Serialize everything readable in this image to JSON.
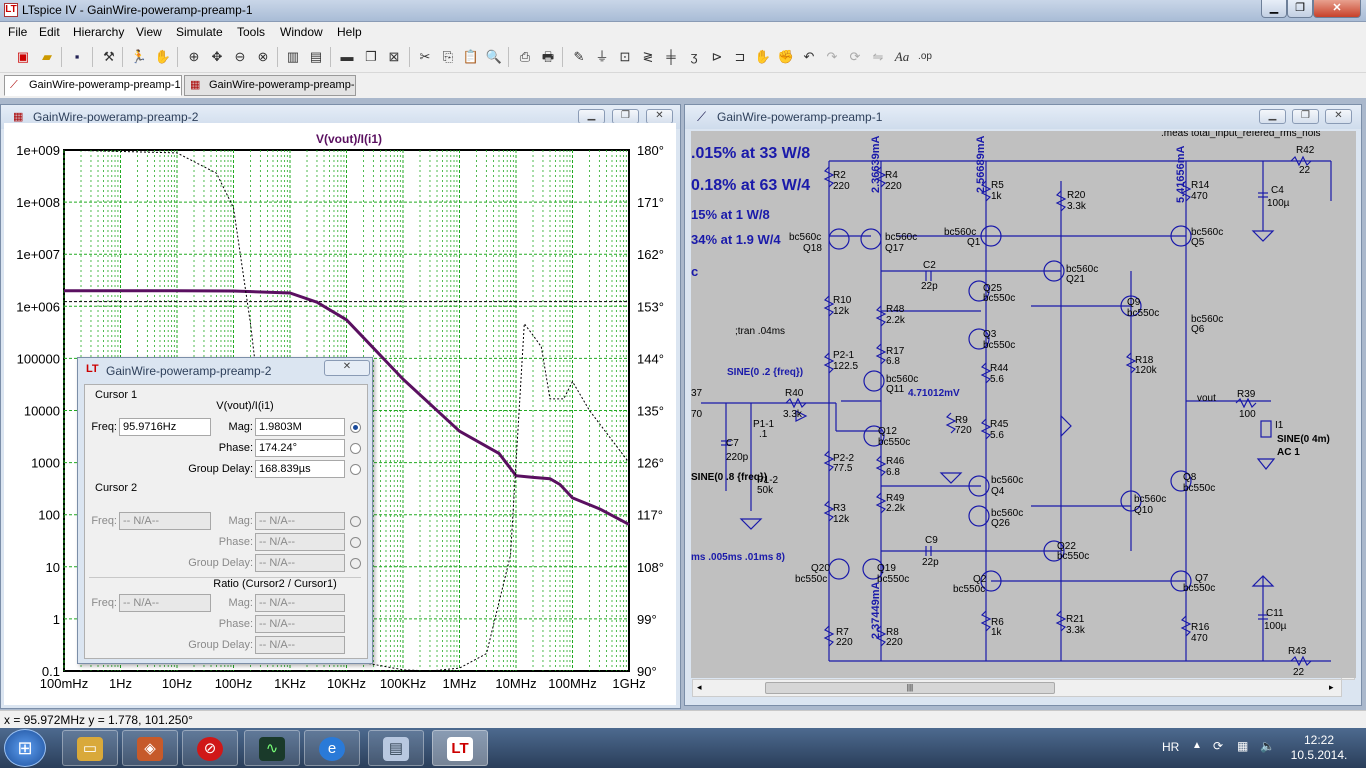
{
  "app": {
    "title": "LTspice IV - GainWire-poweramp-preamp-1",
    "icon": "ltspice-logo-icon"
  },
  "menu": [
    "File",
    "Edit",
    "Hierarchy",
    "View",
    "Simulate",
    "Tools",
    "Window",
    "Help"
  ],
  "tabs": [
    {
      "label": "GainWire-poweramp-preamp-1",
      "active": true
    },
    {
      "label": "GainWire-poweramp-preamp-2",
      "active": false
    }
  ],
  "plot_window": {
    "title": "GainWire-poweramp-preamp-2",
    "trace_label": "V(vout)/I(i1)"
  },
  "chart_data": {
    "type": "line",
    "title": "V(vout)/I(i1)",
    "xscale": "log",
    "yscale": "log",
    "x_ticks": [
      "100mHz",
      "1Hz",
      "10Hz",
      "100Hz",
      "1KHz",
      "10KHz",
      "100KHz",
      "1MHz",
      "10MHz",
      "100MHz",
      "1GHz"
    ],
    "y_ticks": [
      "1e+009",
      "1e+008",
      "1e+007",
      "1e+006",
      "100000",
      "10000",
      "1000",
      "100",
      "10",
      "1",
      "0.1"
    ],
    "y2_ticks": [
      "180°",
      "171°",
      "162°",
      "153°",
      "144°",
      "135°",
      "126°",
      "117°",
      "108°",
      "99°",
      "90°"
    ],
    "xlim": [
      0.1,
      1000000000
    ],
    "ylim": [
      0.1,
      1000000000
    ],
    "y2lim": [
      90,
      180
    ],
    "grid": true,
    "series": [
      {
        "name": "V(vout)/I(i1)",
        "style": "magnitude",
        "color": "#5a1060",
        "x": [
          0.1,
          1,
          10,
          100,
          1000,
          3000,
          10000,
          100000,
          1000000,
          5000000,
          10000000,
          20000000,
          40000000,
          60000000,
          100000000,
          300000000,
          1000000000
        ],
        "y": [
          1980000,
          1980000,
          1980000,
          1970000,
          1800000,
          1200000,
          550000,
          40000,
          4000,
          1500,
          560,
          520,
          490,
          380,
          210,
          130,
          65
        ]
      },
      {
        "name": "phase",
        "style": "dashed",
        "color": "#000000",
        "x": [
          0.1,
          10,
          50,
          100,
          200,
          400,
          800,
          2000,
          10000,
          100000,
          300000,
          1000000,
          3000000,
          8000000,
          14000000,
          20000000,
          28000000,
          40000000,
          70000000,
          100000000,
          200000000,
          1000000000
        ],
        "y": [
          180,
          179.5,
          176,
          170,
          150,
          125,
          108,
          98,
          92,
          90.2,
          90,
          90.5,
          93,
          110,
          150,
          148,
          146,
          137,
          137,
          140,
          135,
          126
        ]
      }
    ],
    "reference_line": {
      "y2": 153.8,
      "style": "dashed"
    }
  },
  "cursor_dialog": {
    "title": "GainWire-poweramp-preamp-2",
    "cursor1_label": "Cursor 1",
    "cursor2_label": "Cursor 2",
    "trace": "V(vout)/I(i1)",
    "c1": {
      "freq": "95.9716Hz",
      "mag": "1.9803M",
      "phase": "174.24°",
      "group_delay": "168.839µs"
    },
    "c2": {
      "freq": "-- N/A--",
      "mag": "-- N/A--",
      "phase": "-- N/A--",
      "group_delay": "-- N/A--"
    },
    "ratio_label": "Ratio (Cursor2 / Cursor1)",
    "ratio": {
      "freq": "-- N/A--",
      "mag": "-- N/A--",
      "phase": "-- N/A--",
      "group_delay": "-- N/A--"
    },
    "labels": {
      "freq": "Freq:",
      "mag": "Mag:",
      "phase": "Phase:",
      "group_delay": "Group Delay:"
    }
  },
  "schematic_window": {
    "title": "GainWire-poweramp-preamp-1",
    "big_text": [
      ".015% at 33 W/8",
      "0.18% at 63 W/4",
      "15% at 1 W/8",
      "34% at 1.9 W/4"
    ],
    "directives": [
      ".meas total_input_refered_rms_nois",
      ";tran .04ms",
      "SINE(0 .2 {freq})",
      "SINE(0 .8 {freq})",
      "ms .005ms .01ms 8)",
      "SINE(0 4m)",
      "AC 1"
    ],
    "currents": [
      "2.36639mA",
      "2.56689mA",
      "5.41656mA",
      "2.37449mA",
      "4.71012mV"
    ],
    "components": {
      "r2": "R2",
      "r2v": "220",
      "r4": "R4",
      "r4v": "220",
      "r5": "R5",
      "r5v": "1k",
      "r20": "R20",
      "r20v": "3.3k",
      "r14": "R14",
      "r14v": "470",
      "r42": "R42",
      "r42v": "22",
      "c4": "C4",
      "c4v": "100µ",
      "q18": "Q18",
      "q17": "Q17",
      "q1": "Q1",
      "q5": "Q5",
      "bc560c": "bc560c",
      "bc550c": "bc550c",
      "c2": "C2",
      "c2v": "22p",
      "q25": "Q25",
      "q21": "Q21",
      "r10": "R10",
      "r10v": "12k",
      "r48": "R48",
      "r48v": "2.2k",
      "q9": "Q9",
      "q6": "Q6",
      "q3": "Q3",
      "r17": "R17",
      "r17v": "6.8",
      "p21": "P2-1",
      "p21v": "122.5",
      "r44": "R44",
      "r44v": "5.6",
      "r18": "R18",
      "r18v": "120k",
      "q11": "Q11",
      "r40": "R40",
      "r40v": "3.3k",
      "r9": "R9",
      "r9v": "720",
      "r45": "R45",
      "r45v": "5.6",
      "vout": "vout",
      "r39": "R39",
      "r39v": "100",
      "i1": "I1",
      "p11": "P1-1",
      "p11v": ".1",
      "c7": "C7",
      "c7v": "220p",
      "q12": "Q12",
      "p22": "P2-2",
      "p22v": "77.5",
      "r46": "R46",
      "r46v": "6.8",
      "q8": "Q8",
      "q4": "Q4",
      "p12": "P1-2",
      "p12v": "50k",
      "r49": "R49",
      "r49v": "2.2k",
      "q10": "Q10",
      "r3": "R3",
      "r3v": "12k",
      "q26": "Q26",
      "c9": "C9",
      "c9v": "22p",
      "q22": "Q22",
      "q20": "Q20",
      "q19": "Q19",
      "q2": "Q2",
      "q7": "Q7",
      "c11": "C11",
      "c11v": "100µ",
      "r6": "R6",
      "r6v": "1k",
      "r21": "R21",
      "r21v": "3.3k",
      "r16": "R16",
      "r16v": "470",
      "r7": "R7",
      "r7v": "220",
      "r8": "R8",
      "r8v": "220",
      "r43": "R43",
      "r43v": "22",
      "r37": "37",
      "r37v": "70"
    }
  },
  "status": {
    "coords": "x = 95.972MHz    y = 1.778, 101.250°"
  },
  "taskbar": {
    "lang": "HR",
    "time": "12:22",
    "date": "10.5.2014."
  }
}
